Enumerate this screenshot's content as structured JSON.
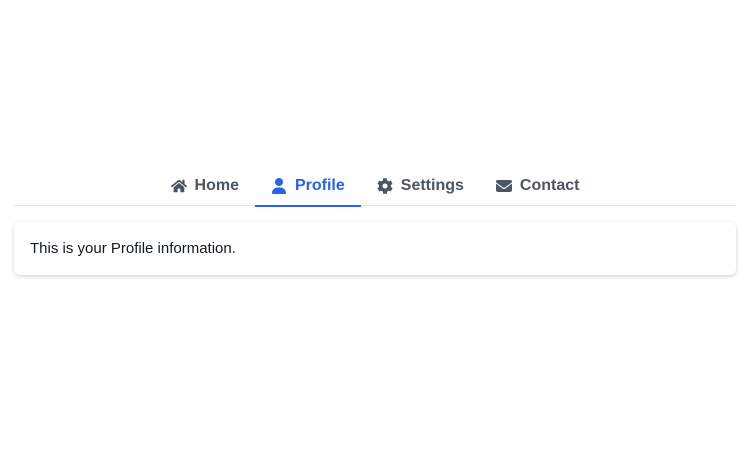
{
  "tabs": [
    {
      "label": "Home",
      "icon": "home-icon",
      "active": false
    },
    {
      "label": "Profile",
      "icon": "user-icon",
      "active": true
    },
    {
      "label": "Settings",
      "icon": "gear-icon",
      "active": false
    },
    {
      "label": "Contact",
      "icon": "envelope-icon",
      "active": false
    }
  ],
  "panel": {
    "text": "This is your Profile information."
  },
  "colors": {
    "accent": "#2563eb",
    "tab_text": "#4b5563",
    "body_text": "#111827",
    "divider": "#e5e7eb"
  }
}
